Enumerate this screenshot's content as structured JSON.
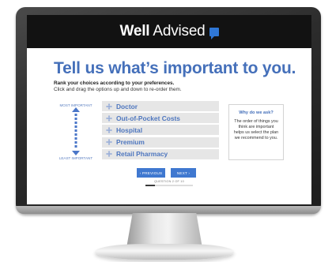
{
  "brand": {
    "bold": "Well",
    "light": "Advised",
    "accent_color": "#2f77d6"
  },
  "page": {
    "headline": "Tell us what’s important to you.",
    "subhead": "Rank your choices according to your preferences.",
    "instructions": "Click and drag the options up and down to re-order them."
  },
  "ranking": {
    "most_label": "MOST IMPORTANT",
    "least_label": "LEAST IMPORTANT",
    "options": [
      {
        "label": "Doctor"
      },
      {
        "label": "Out-of-Pocket Costs"
      },
      {
        "label": "Hospital"
      },
      {
        "label": "Premium"
      },
      {
        "label": "Retail Pharmacy"
      }
    ]
  },
  "why": {
    "title": "Why do we ask?",
    "text": "The order of things you think are important helps us select the plan we recommend to you."
  },
  "nav": {
    "prev_label": "‹ PREVIOUS",
    "next_label": "NEXT ›",
    "question_text": "QUESTION 2 OF 10",
    "progress": 0.2
  },
  "colors": {
    "primary": "#4570ba",
    "button": "#3f78d0",
    "header_bg": "#121212",
    "option_bg": "#e6e6e6"
  }
}
